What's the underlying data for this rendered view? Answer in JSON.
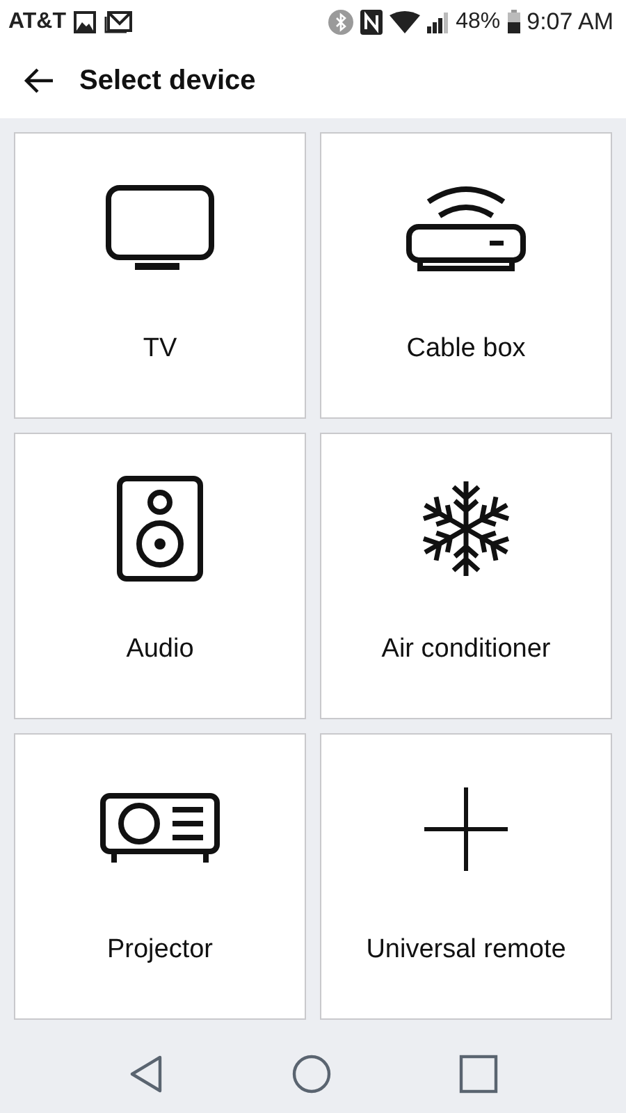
{
  "status_bar": {
    "carrier": "AT&T",
    "battery": "48%",
    "time": "9:07 AM"
  },
  "header": {
    "title": "Select device"
  },
  "devices": [
    {
      "kind": "tv",
      "label": "TV"
    },
    {
      "kind": "cable_box",
      "label": "Cable box"
    },
    {
      "kind": "audio",
      "label": "Audio"
    },
    {
      "kind": "air_conditioner",
      "label": "Air conditioner"
    },
    {
      "kind": "projector",
      "label": "Projector"
    },
    {
      "kind": "add",
      "label": "Universal remote"
    }
  ]
}
